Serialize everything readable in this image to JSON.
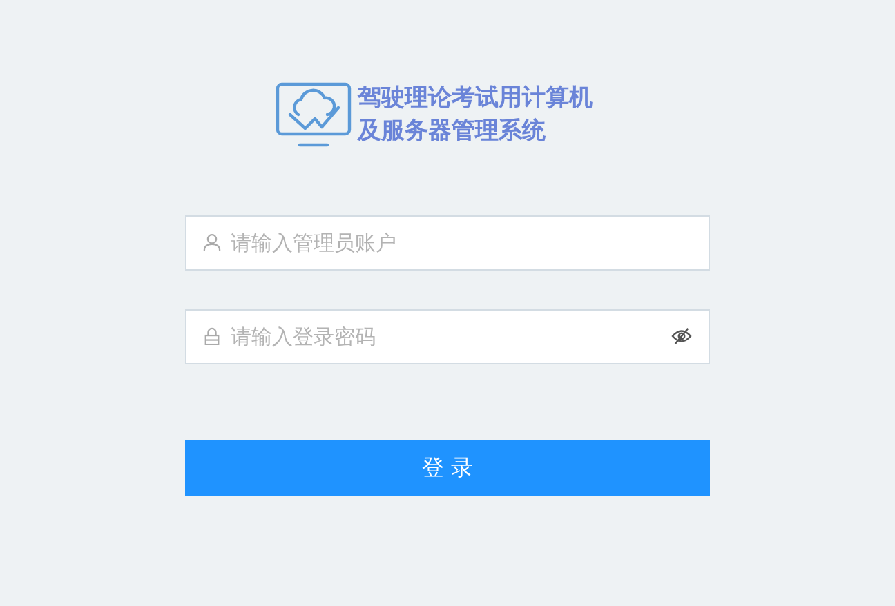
{
  "title_lines": [
    "驾驶理论考试用计算机",
    "及服务器管理系统"
  ],
  "fields": [
    {
      "kind": "account",
      "placeholder": "请输入管理员账户"
    },
    {
      "kind": "password",
      "placeholder": "请输入登录密码"
    }
  ],
  "login_button": "登 录"
}
